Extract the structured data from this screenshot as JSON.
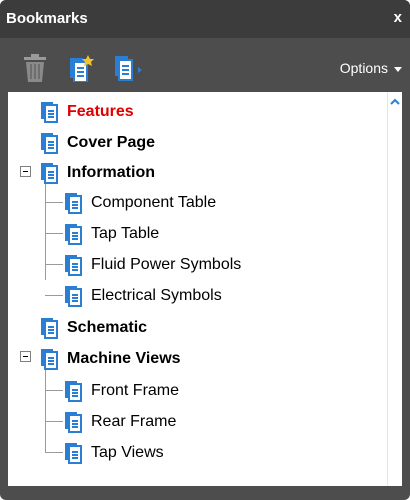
{
  "panel": {
    "title": "Bookmarks",
    "close_label": "x",
    "options_label": "Options"
  },
  "toolbar": {
    "icons": [
      "trash-icon",
      "new-bookmark-icon",
      "expand-bookmark-icon"
    ]
  },
  "bookmarks": [
    {
      "label": "Features",
      "active": true
    },
    {
      "label": "Cover Page"
    },
    {
      "label": "Information",
      "expanded": true,
      "children": [
        {
          "label": "Component Table"
        },
        {
          "label": "Tap Table"
        },
        {
          "label": "Fluid Power Symbols"
        },
        {
          "label": "Electrical Symbols"
        }
      ]
    },
    {
      "label": "Schematic"
    },
    {
      "label": "Machine Views",
      "expanded": true,
      "children": [
        {
          "label": "Front Frame"
        },
        {
          "label": "Rear Frame"
        },
        {
          "label": "Tap Views"
        }
      ]
    }
  ],
  "colors": {
    "panel_bg": "#4d4d4d",
    "titlebar_bg": "#3c3c3c",
    "active_text": "#e00000",
    "icon_blue": "#2a7fd4"
  }
}
